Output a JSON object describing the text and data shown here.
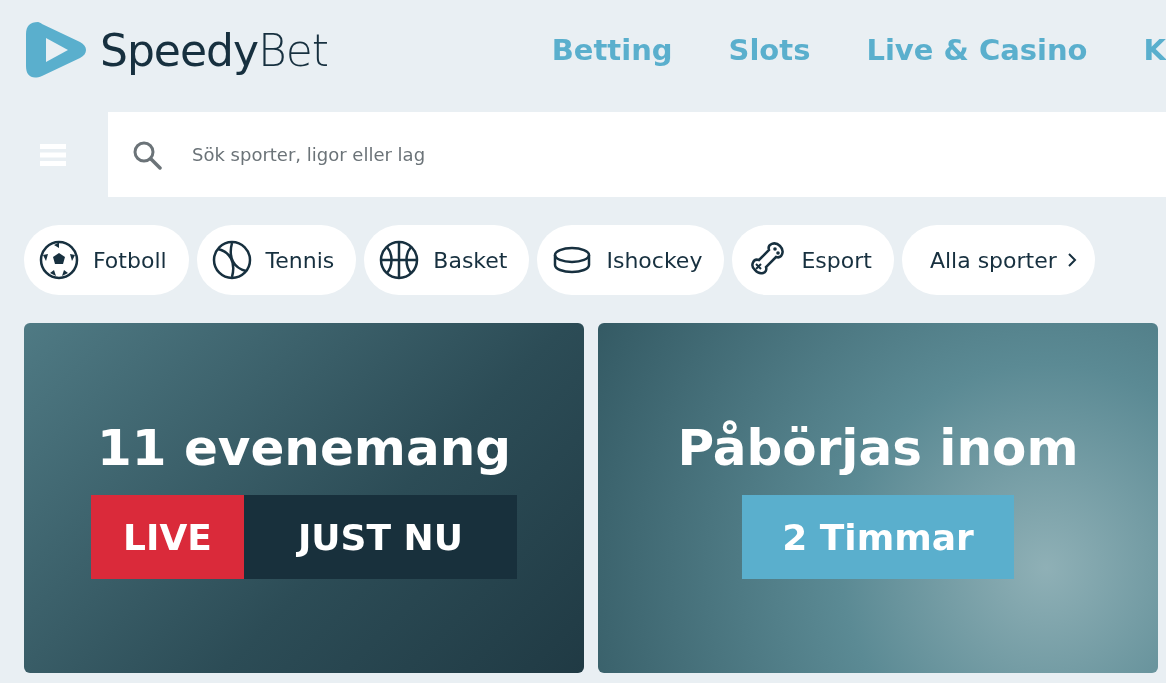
{
  "logo": {
    "text": "**Speedy**Bet"
  },
  "nav": [
    {
      "label": "Betting"
    },
    {
      "label": "Slots"
    },
    {
      "label": "Live & Casino"
    },
    {
      "label": "K"
    }
  ],
  "search": {
    "placeholder": "Sök sporter, ligor eller lag"
  },
  "sports": [
    {
      "label": "Fotboll",
      "kind": "football"
    },
    {
      "label": "Tennis",
      "kind": "tennis"
    },
    {
      "label": "Basket",
      "kind": "basketball"
    },
    {
      "label": "Ishockey",
      "kind": "puck"
    },
    {
      "label": "Esport",
      "kind": "gamepad"
    },
    {
      "label": "Alla sporter",
      "kind": "more"
    }
  ],
  "banners": [
    {
      "title": "11 evenemang",
      "tags": [
        {
          "text": "LIVE",
          "kind": "live"
        },
        {
          "text": "JUST NU",
          "kind": "plain"
        }
      ]
    },
    {
      "title": "Påbörjas inom",
      "tags": [
        {
          "text": "2 Timmar",
          "kind": "highlight"
        }
      ]
    }
  ]
}
